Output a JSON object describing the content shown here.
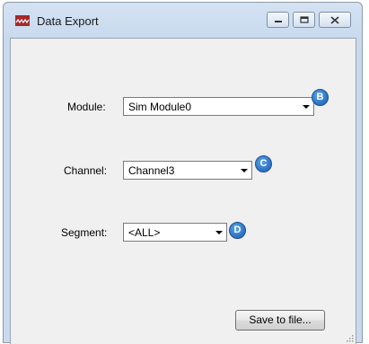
{
  "window": {
    "title": "Data Export",
    "controls": [
      "minimize",
      "maximize",
      "close"
    ]
  },
  "form": {
    "module": {
      "label": "Module:",
      "value": "Sim Module0",
      "badge": "B"
    },
    "channel": {
      "label": "Channel:",
      "value": "Channel3",
      "badge": "C"
    },
    "segment": {
      "label": "Segment:",
      "value": "<ALL>",
      "badge": "D"
    }
  },
  "actions": {
    "save_label": "Save to file..."
  },
  "colors": {
    "badge": "#2b6fc2",
    "titlebar": "#c9daef",
    "client": "#f0f0f0",
    "app_icon": "#a8262a"
  },
  "icons": [
    "app-icon",
    "minimize-icon",
    "maximize-icon",
    "close-icon",
    "chevron-down-icon",
    "resize-grip-icon"
  ]
}
